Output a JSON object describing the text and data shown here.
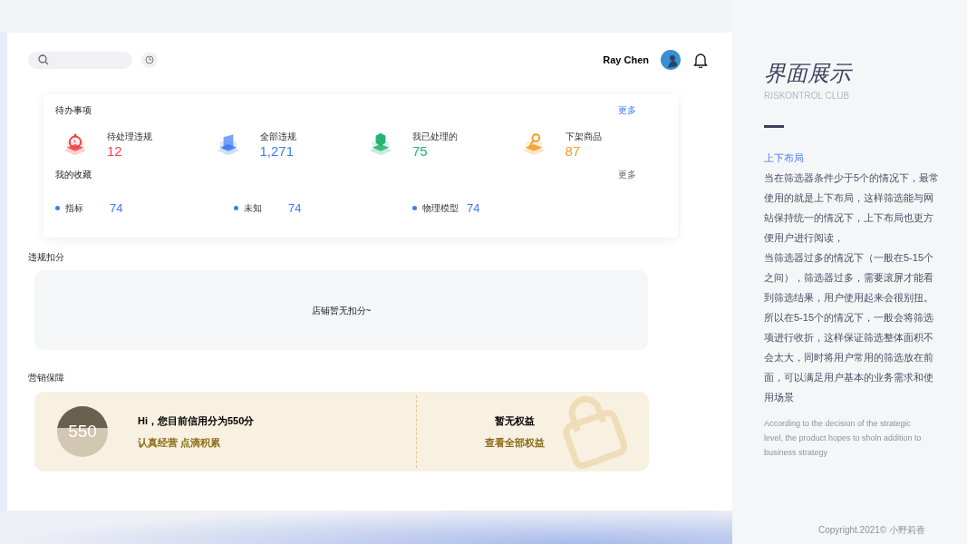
{
  "header": {
    "user_name": "Ray Chen"
  },
  "todo": {
    "title": "待办事项",
    "more": "更多",
    "items": [
      {
        "kind": "alarm",
        "label": "待处理违规",
        "value": "12",
        "color": "#f0434b"
      },
      {
        "kind": "document",
        "label": "全部违规",
        "value": "1,271",
        "color": "#3f7cf4"
      },
      {
        "kind": "shield",
        "label": "我已处理的",
        "value": "75",
        "color": "#22b573"
      },
      {
        "kind": "magnifier",
        "label": "下架商品",
        "value": "87",
        "color": "#f59a23"
      }
    ]
  },
  "favorites": {
    "title": "我的收藏",
    "more": "更多",
    "items": [
      {
        "label": "指标",
        "value": "74",
        "color": "#3f7cf4"
      },
      {
        "label": "未知",
        "value": "74",
        "color": "#3f7cf4"
      },
      {
        "label": "物理模型",
        "value": "74",
        "color": "#3f7cf4"
      }
    ]
  },
  "penalty": {
    "title": "违规扣分",
    "empty_text": "店铺暂无扣分~"
  },
  "marketing": {
    "title": "营销保障",
    "score": "550",
    "greeting": "Hi，您目前信用分为550分",
    "slogan": "认真经营 点滴积累",
    "rights_title": "暂无权益",
    "rights_link": "查看全部权益"
  },
  "side": {
    "title": "界面展示",
    "subtitle": "RISKONTROL CLUB",
    "section_title": "上下布局",
    "paragraphs": [
      "当在筛选器条件少于5个的情况下，最常使用的就是上下布局，这样筛选能与网站保持统一的情况下，上下布局也更方便用户进行阅读，",
      "当筛选器过多的情况下（一般在5-15个之间），筛选器过多，需要滚屏才能看到筛选结果，用户使用起来会很别扭。所以在5-15个的情况下，一般会将筛选项进行收折，这样保证筛选整体面积不会太大，同时将用户常用的筛选放在前面，可以满足用户基本的业务需求和使用场景"
    ],
    "english": "According to the decision of the strategic level, the product hopes to sholn addition to business strategy",
    "copyright": "Copyright.2021© 小野莉香"
  }
}
